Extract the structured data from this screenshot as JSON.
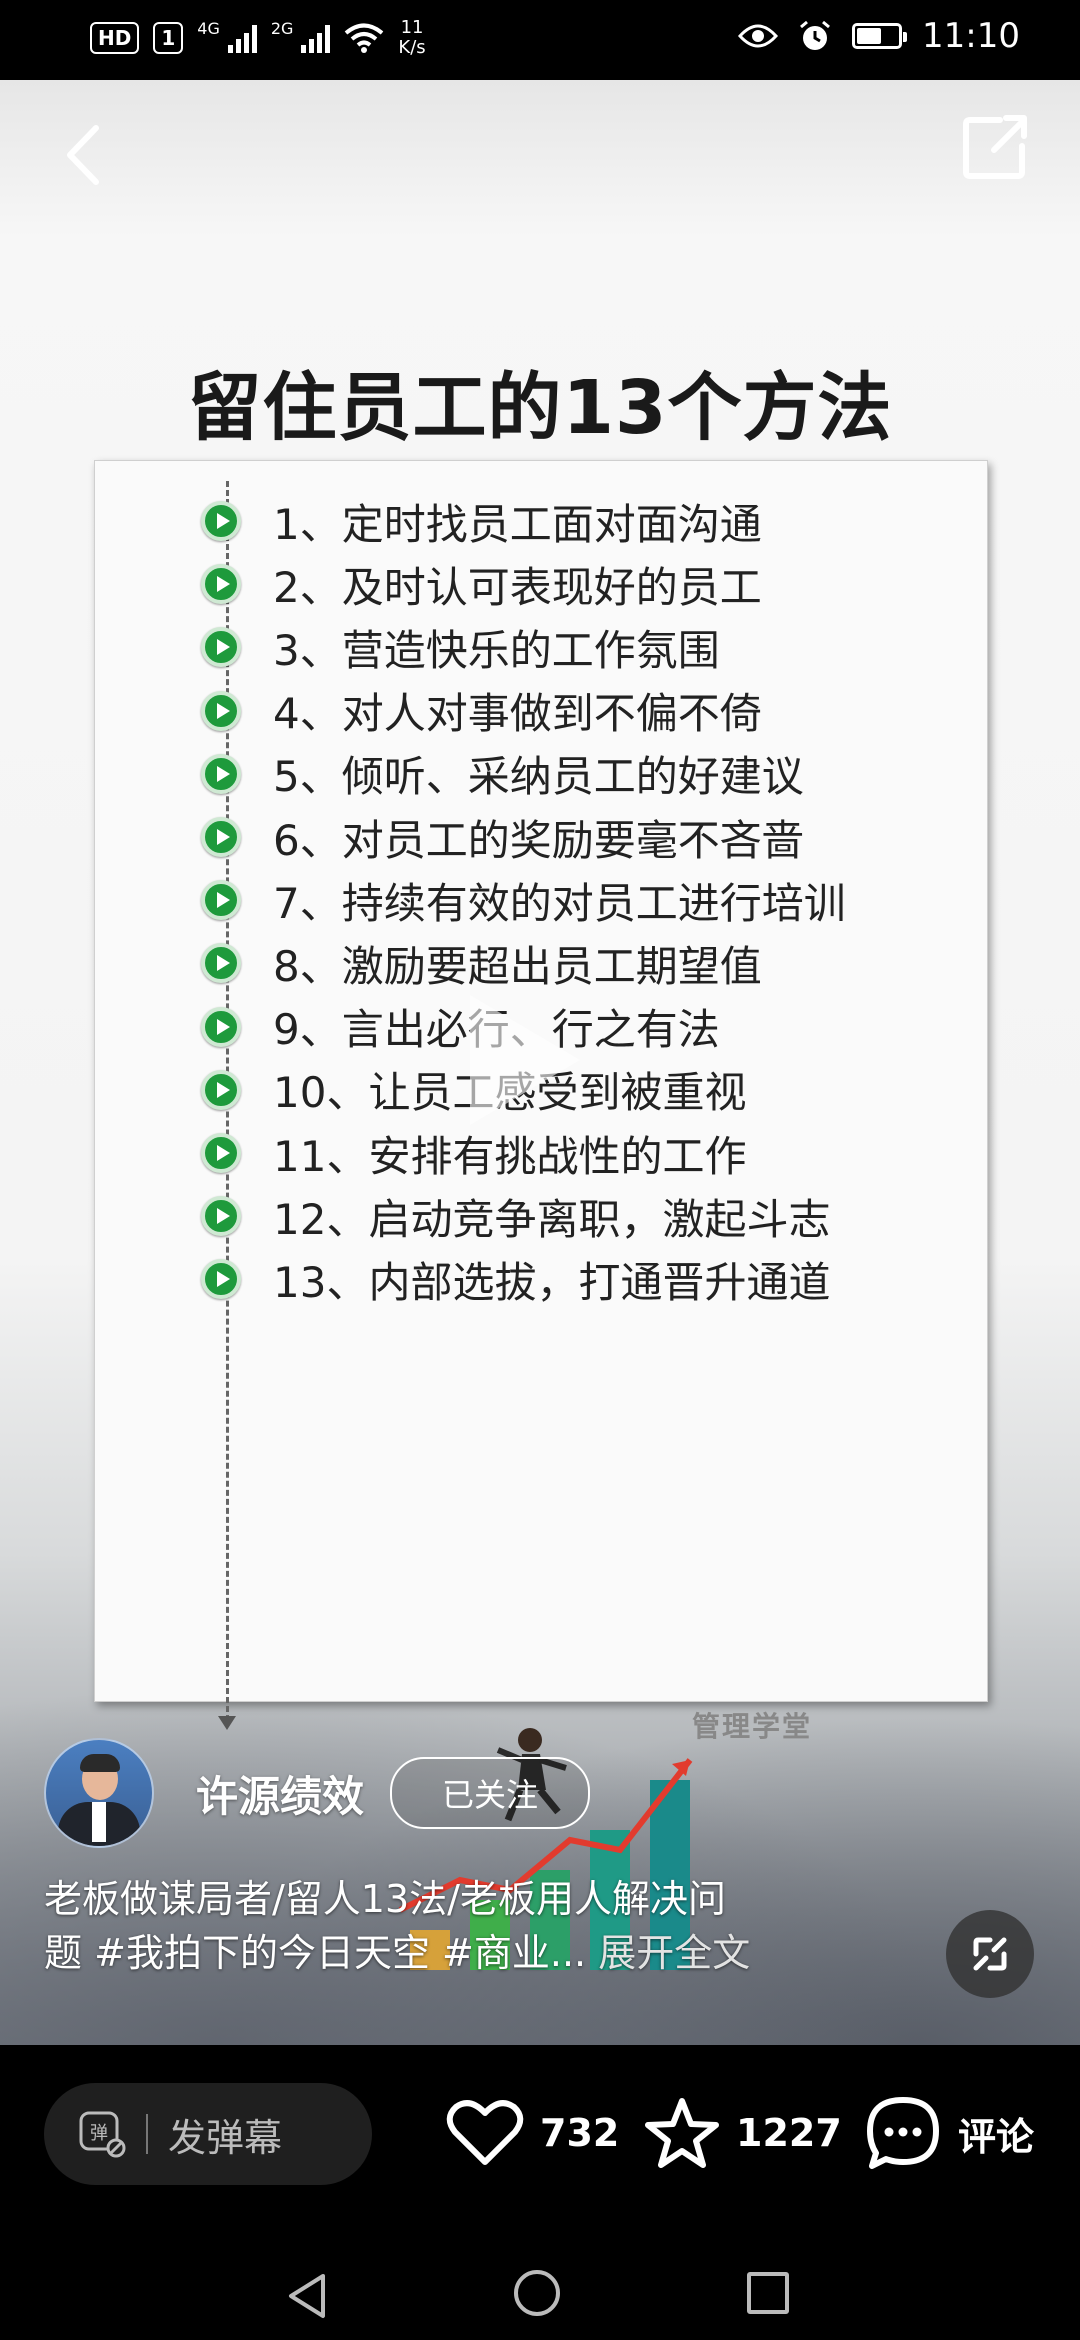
{
  "status_bar": {
    "hd_badge": "HD",
    "sim_tag": "1",
    "net_1": "4G",
    "net_2": "2G",
    "speed_value": "11",
    "speed_unit": "K/s",
    "time": "11:10",
    "battery_level": 0.6
  },
  "poster": {
    "title": "留住员工的13个方法",
    "items": [
      "1、定时找员工面对面沟通",
      "2、及时认可表现好的员工",
      "3、营造快乐的工作氛围",
      "4、对人对事做到不偏不倚",
      "5、倾听、采纳员工的好建议",
      "6、对员工的奖励要毫不吝啬",
      "7、持续有效的对员工进行培训",
      "8、激励要超出员工期望值",
      "9、言出必行、行之有法",
      "10、让员工感受到被重视",
      "11、安排有挑战性的工作",
      "12、启动竞争离职，激起斗志",
      "13、内部选拔，打通晋升通道"
    ],
    "watermark": "管理学堂"
  },
  "author": {
    "name": "许源绩效",
    "follow_label": "已关注"
  },
  "caption": {
    "line1": "老板做谋局者/留人13法/老板用人解决问",
    "line2_text": "题",
    "tag1": "#我拍下的今日天空",
    "tag2": "#商业...",
    "expand_label": "展开全文"
  },
  "actions": {
    "danmaku_placeholder": "发弹幕",
    "likes": "732",
    "favorites": "1227",
    "comment_label": "评论"
  },
  "colors": {
    "accent_green": "#1e9a3c",
    "background": "#000000"
  }
}
